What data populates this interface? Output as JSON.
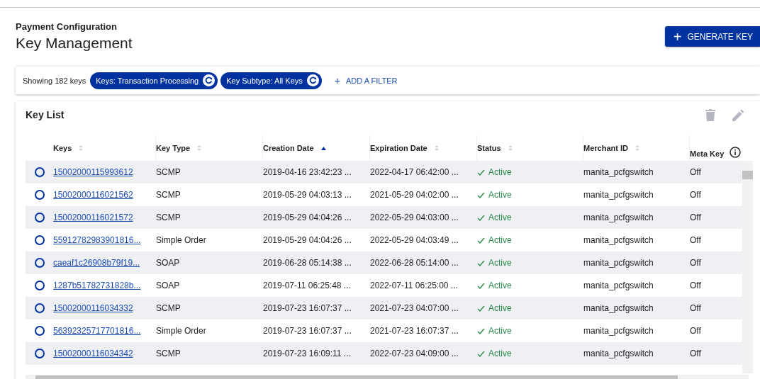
{
  "breadcrumb": "Payment Configuration",
  "title": "Key Management",
  "generate_button": {
    "icon": "+",
    "label": "GENERATE KEY"
  },
  "filter_bar": {
    "count": "Showing 182 keys",
    "chips": [
      {
        "label": "Keys: Transaction Processing"
      },
      {
        "label": "Key Subtype: All Keys"
      }
    ],
    "add_filter": {
      "icon": "+",
      "label": "ADD A FILTER"
    }
  },
  "key_list": {
    "title": "Key List",
    "columns": [
      {
        "label": "Keys",
        "kind": "sortable"
      },
      {
        "label": "Key Type",
        "kind": "sortable"
      },
      {
        "label": "Creation Date",
        "kind": "sorted"
      },
      {
        "label": "Expiration Date",
        "kind": "sortable"
      },
      {
        "label": "Status",
        "kind": "sortable"
      },
      {
        "label": "Merchant ID",
        "kind": "sortable"
      },
      {
        "label": "Meta Key",
        "kind": "info"
      }
    ],
    "rows": [
      {
        "selected": false,
        "key": "15002000115993612",
        "key_type": "SCMP",
        "creation_date": "2019-04-16 23:42:23 ...",
        "expiration_date": "2022-04-17 06:42:00 ...",
        "status": "Active",
        "merchant_id": "manita_pcfgswitch",
        "meta_key": "Off"
      },
      {
        "selected": false,
        "key": "15002000116021562",
        "key_type": "SCMP",
        "creation_date": "2019-05-29 04:03:13 ...",
        "expiration_date": "2021-05-29 04:02:00 ...",
        "status": "Active",
        "merchant_id": "manita_pcfgswitch",
        "meta_key": "Off"
      },
      {
        "selected": false,
        "key": "15002000116021572",
        "key_type": "SCMP",
        "creation_date": "2019-05-29 04:04:26 ...",
        "expiration_date": "2022-05-29 04:03:00 ...",
        "status": "Active",
        "merchant_id": "manita_pcfgswitch",
        "meta_key": "Off"
      },
      {
        "selected": false,
        "key": "55912782983901816...",
        "key_type": "Simple Order",
        "creation_date": "2019-05-29 04:04:26 ...",
        "expiration_date": "2022-05-29 04:03:49 ...",
        "status": "Active",
        "merchant_id": "manita_pcfgswitch",
        "meta_key": "Off"
      },
      {
        "selected": false,
        "key": "caeaf1c26908b79f19...",
        "key_type": "SOAP",
        "creation_date": "2019-06-28 05:14:38 ...",
        "expiration_date": "2022-06-28 05:14:00 ...",
        "status": "Active",
        "merchant_id": "manita_pcfgswitch",
        "meta_key": "Off"
      },
      {
        "selected": false,
        "key": "1287b51782731828b...",
        "key_type": "SOAP",
        "creation_date": "2019-07-11 06:25:48 ...",
        "expiration_date": "2022-07-11 06:25:00 ...",
        "status": "Active",
        "merchant_id": "manita_pcfgswitch",
        "meta_key": "Off"
      },
      {
        "selected": false,
        "key": "15002000116034332",
        "key_type": "SCMP",
        "creation_date": "2019-07-23 16:07:37 ...",
        "expiration_date": "2021-07-23 04:07:00 ...",
        "status": "Active",
        "merchant_id": "manita_pcfgswitch",
        "meta_key": "Off"
      },
      {
        "selected": false,
        "key": "56392325717701816...",
        "key_type": "Simple Order",
        "creation_date": "2019-07-23 16:07:37 ...",
        "expiration_date": "2021-07-23 16:07:37 ...",
        "status": "Active",
        "merchant_id": "manita_pcfgswitch",
        "meta_key": "Off"
      },
      {
        "selected": false,
        "key": "15002000116034342",
        "key_type": "SCMP",
        "creation_date": "2019-07-23 16:09:11 ...",
        "expiration_date": "2022-07-23 04:09:00 ...",
        "status": "Active",
        "merchant_id": "manita_pcfgswitch",
        "meta_key": "Off"
      }
    ]
  }
}
